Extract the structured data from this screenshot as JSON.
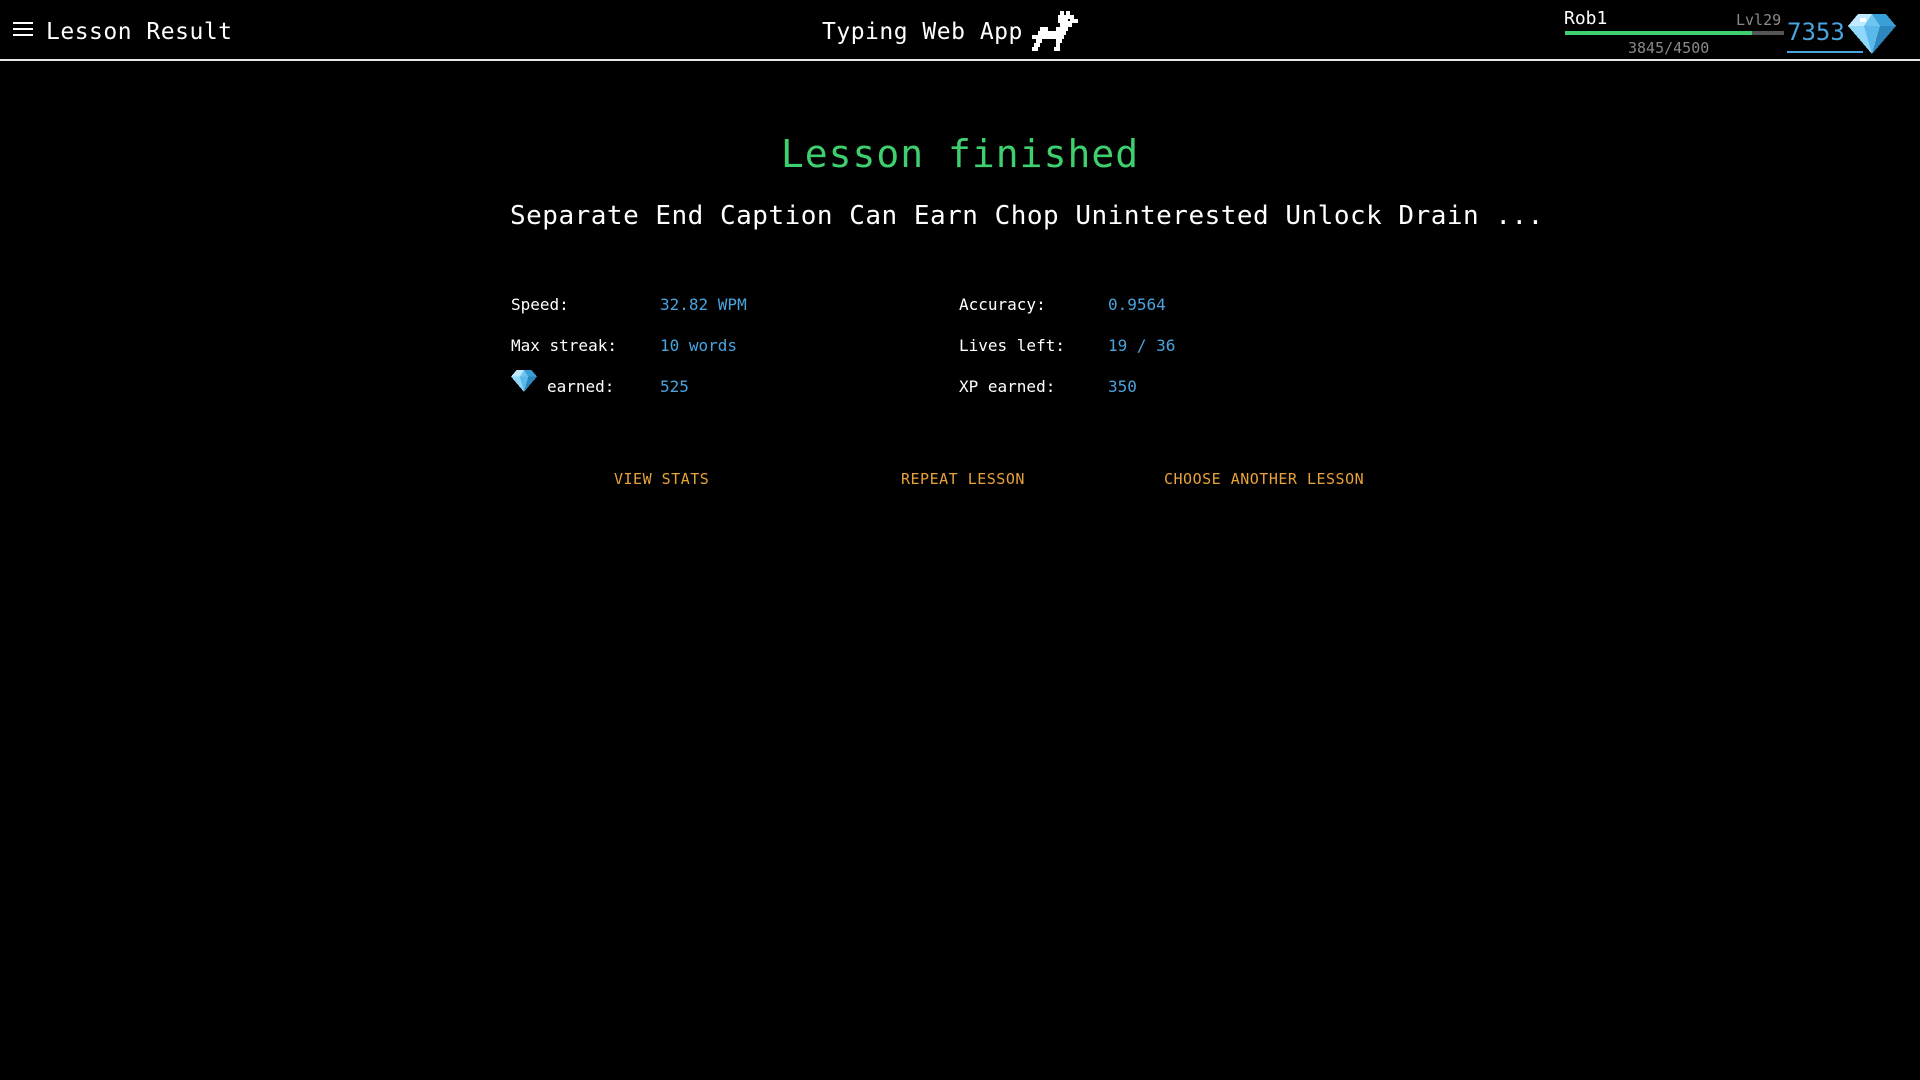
{
  "header": {
    "page_title": "Lesson Result",
    "app_title": "Typing Web App",
    "user": {
      "name": "Rob1",
      "level": "Lvl29",
      "xp_text": "3845/4500",
      "xp_progress": 0.854,
      "gems": "7353"
    }
  },
  "result": {
    "title": "Lesson finished",
    "lesson_text": "Separate End Caption Can Earn Chop Uninterested Unlock Drain ...",
    "stats": {
      "speed_label": "Speed:",
      "speed_value": "32.82 WPM",
      "accuracy_label": "Accuracy:",
      "accuracy_value": "0.9564",
      "max_streak_label": "Max streak:",
      "max_streak_value": "10 words",
      "lives_label": "Lives left:",
      "lives_value": "19 / 36",
      "gems_label": "earned:",
      "gems_value": "525",
      "xp_label": "XP earned:",
      "xp_value": "350"
    }
  },
  "actions": {
    "view_stats": "View stats",
    "repeat_lesson": "Repeat lesson",
    "choose_another": "Choose another lesson"
  },
  "colors": {
    "accent_green": "#3ecf6e",
    "value_blue": "#4aa3df",
    "action_orange": "#e8a23a"
  },
  "icons": [
    "menu-icon",
    "dog-logo-icon",
    "gem-icon"
  ]
}
